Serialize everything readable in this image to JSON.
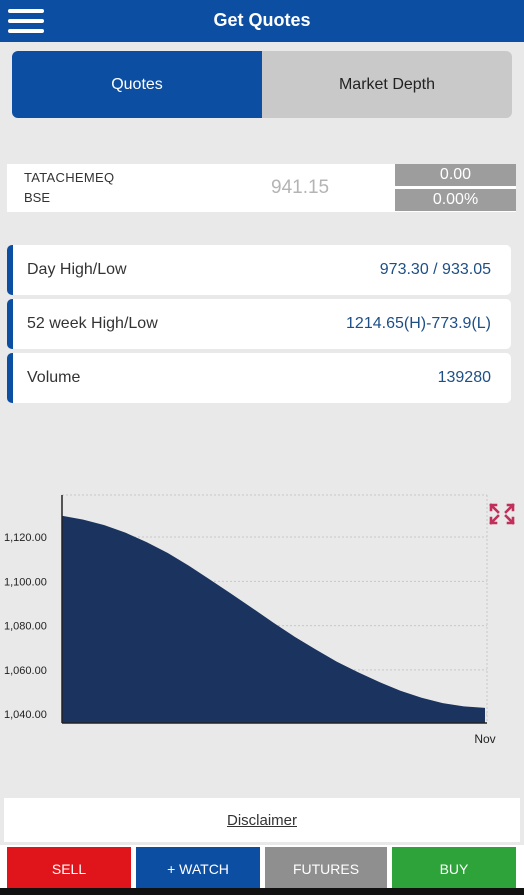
{
  "header": {
    "title": "Get Quotes",
    "menu_icon": "hamburger-menu-icon"
  },
  "tabs": [
    {
      "label": "Quotes",
      "active": true
    },
    {
      "label": "Market Depth",
      "active": false
    }
  ],
  "quote": {
    "symbol": "TATACHEMEQ",
    "exchange": "BSE",
    "ltp": "941.15",
    "change": "0.00",
    "change_pct": "0.00%"
  },
  "stats": [
    {
      "label": "Day High/Low",
      "value": "973.30 / 933.05"
    },
    {
      "label": "52 week High/Low",
      "value": "1214.65(H)-773.9(L)"
    },
    {
      "label": "Volume",
      "value": "139280"
    }
  ],
  "chart_data": {
    "type": "area",
    "title": "",
    "xlabel": "",
    "ylabel": "",
    "x_ticks": [
      "Nov"
    ],
    "y_ticks": [
      "1,040.00",
      "1,060.00",
      "1,080.00",
      "1,100.00",
      "1,120.00"
    ],
    "ylim": [
      1036,
      1139
    ],
    "x": [
      0,
      0.05,
      0.1,
      0.15,
      0.2,
      0.25,
      0.3,
      0.35,
      0.4,
      0.45,
      0.5,
      0.55,
      0.6,
      0.65,
      0.7,
      0.75,
      0.8,
      0.85,
      0.9,
      0.95,
      1.0
    ],
    "values": [
      1129.6,
      1127.9,
      1125.4,
      1122.0,
      1117.7,
      1112.8,
      1107.0,
      1100.8,
      1094.4,
      1087.9,
      1081.3,
      1075.0,
      1069.2,
      1063.7,
      1058.9,
      1054.5,
      1050.6,
      1047.4,
      1045.0,
      1043.5,
      1042.8
    ],
    "fill_color": "#1b335f",
    "grid": true,
    "expand_icon": "expand-arrows-icon"
  },
  "disclaimer": {
    "label": "Disclaimer"
  },
  "actions": {
    "sell": "SELL",
    "watch": "+ WATCH",
    "futures": "FUTURES",
    "buy": "BUY"
  },
  "colors": {
    "primary": "#0c4ea2",
    "sell": "#e0141b",
    "buy": "#2ea33a",
    "neutral": "#8f8f8f"
  }
}
